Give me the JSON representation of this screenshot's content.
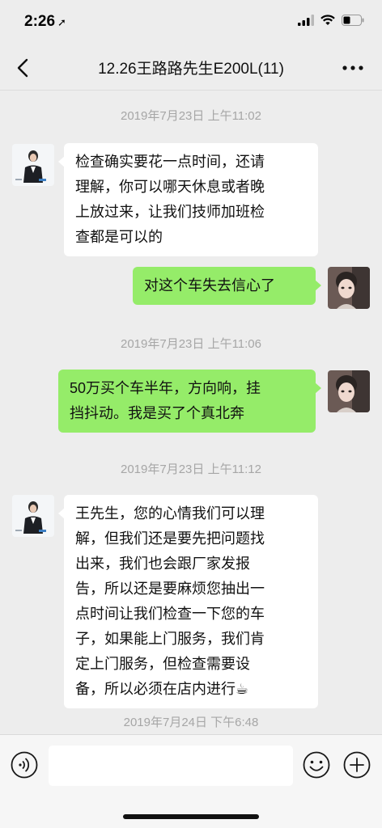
{
  "status_bar": {
    "time": "2:26",
    "location_arrow": "location-arrow-icon"
  },
  "header": {
    "title": "12.26王路路先生E200L(11)"
  },
  "messages": [
    {
      "type": "timestamp",
      "text": "2019年7月23日 上午11:02"
    },
    {
      "type": "message",
      "side": "left",
      "sender": "advisor",
      "text": "检查确实要花一点时间，还请\n理解，你可以哪天休息或者晚\n上放过来，让我们技师加班检\n查都是可以的"
    },
    {
      "type": "message",
      "side": "right",
      "sender": "me",
      "text": "对这个车失去信心了"
    },
    {
      "type": "timestamp",
      "text": "2019年7月23日 上午11:06"
    },
    {
      "type": "message",
      "side": "right",
      "sender": "me",
      "text": "50万买个车半年，方向响，挂\n挡抖动。我是买了个真北奔"
    },
    {
      "type": "timestamp",
      "text": "2019年7月23日 上午11:12"
    },
    {
      "type": "message",
      "side": "left",
      "sender": "advisor",
      "text": "王先生，您的心情我们可以理\n解，但我们还是要先把问题找\n出来，我们也会跟厂家发报\n告，所以还是要麻烦您抽出一\n点时间让我们检查一下您的车\n子，如果能上门服务，我们肯\n定上门服务，但检查需要设\n备，所以必须在店内进行☕"
    },
    {
      "type": "timestamp",
      "text": "2019年7月24日 下午6:48"
    }
  ],
  "input_bar": {
    "value": "",
    "placeholder": ""
  },
  "colors": {
    "background": "#ededed",
    "bubble_me": "#95ec69",
    "bubble_other": "#ffffff",
    "timestamp": "#a6a6a6"
  },
  "icons": [
    "back-chevron-icon",
    "more-dots-icon",
    "voice-icon",
    "emoji-icon",
    "plus-icon"
  ]
}
